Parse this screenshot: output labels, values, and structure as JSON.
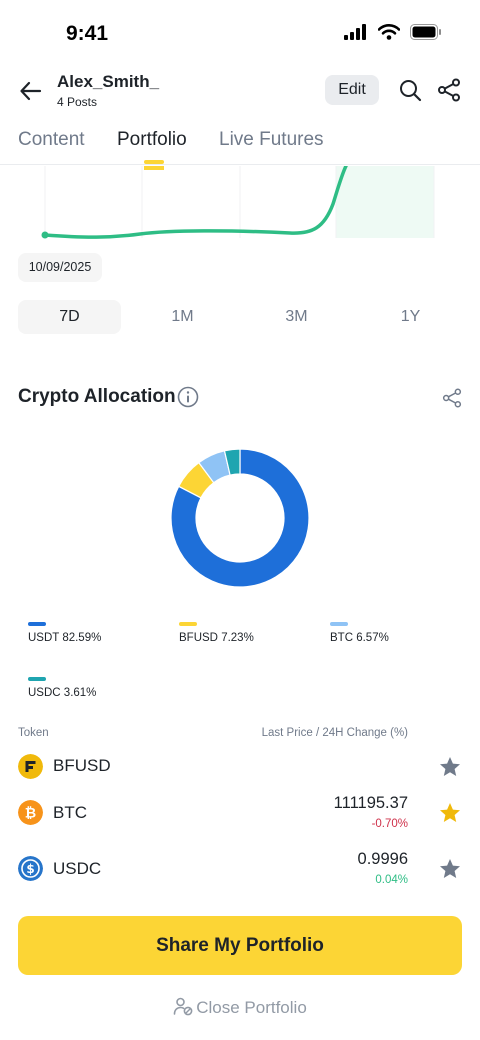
{
  "status_bar": {
    "time": "9:41"
  },
  "header": {
    "username": "Alex_Smith_",
    "posts": "4 Posts",
    "edit_label": "Edit"
  },
  "tabs": [
    {
      "label": "Content"
    },
    {
      "label": "Portfolio"
    },
    {
      "label": "Live Futures"
    }
  ],
  "chart": {
    "date": "10/09/2025",
    "line_color": "#2ebd85"
  },
  "periods": [
    {
      "label": "7D"
    },
    {
      "label": "1M"
    },
    {
      "label": "3M"
    },
    {
      "label": "1Y"
    }
  ],
  "allocation": {
    "title": "Crypto Allocation",
    "items": [
      {
        "label": "USDT",
        "pct": "82.59%",
        "value": 82.59,
        "color": "#1e6fd9"
      },
      {
        "label": "BFUSD",
        "pct": "7.23%",
        "value": 7.23,
        "color": "#fcd535"
      },
      {
        "label": "BTC",
        "pct": "6.57%",
        "value": 6.57,
        "color": "#8fc3f5"
      },
      {
        "label": "USDC",
        "pct": "3.61%",
        "value": 3.61,
        "color": "#1fa5b0"
      }
    ]
  },
  "tokens": {
    "header_left": "Token",
    "header_right": "Last Price / 24H Change (%)",
    "rows": [
      {
        "name": "BFUSD",
        "price": "",
        "change": "",
        "icon": "bfusd-icon",
        "starred": false
      },
      {
        "name": "BTC",
        "price": "111195.37",
        "change": "-0.70%",
        "icon": "btc-icon",
        "starred": true,
        "change_color": "#cf304a"
      },
      {
        "name": "USDC",
        "price": "0.9996",
        "change": "0.04%",
        "icon": "usdc-icon",
        "starred": false,
        "change_color": "#2ebd85"
      }
    ]
  },
  "actions": {
    "share_label": "Share My Portfolio",
    "close_label": "Close Portfolio"
  }
}
